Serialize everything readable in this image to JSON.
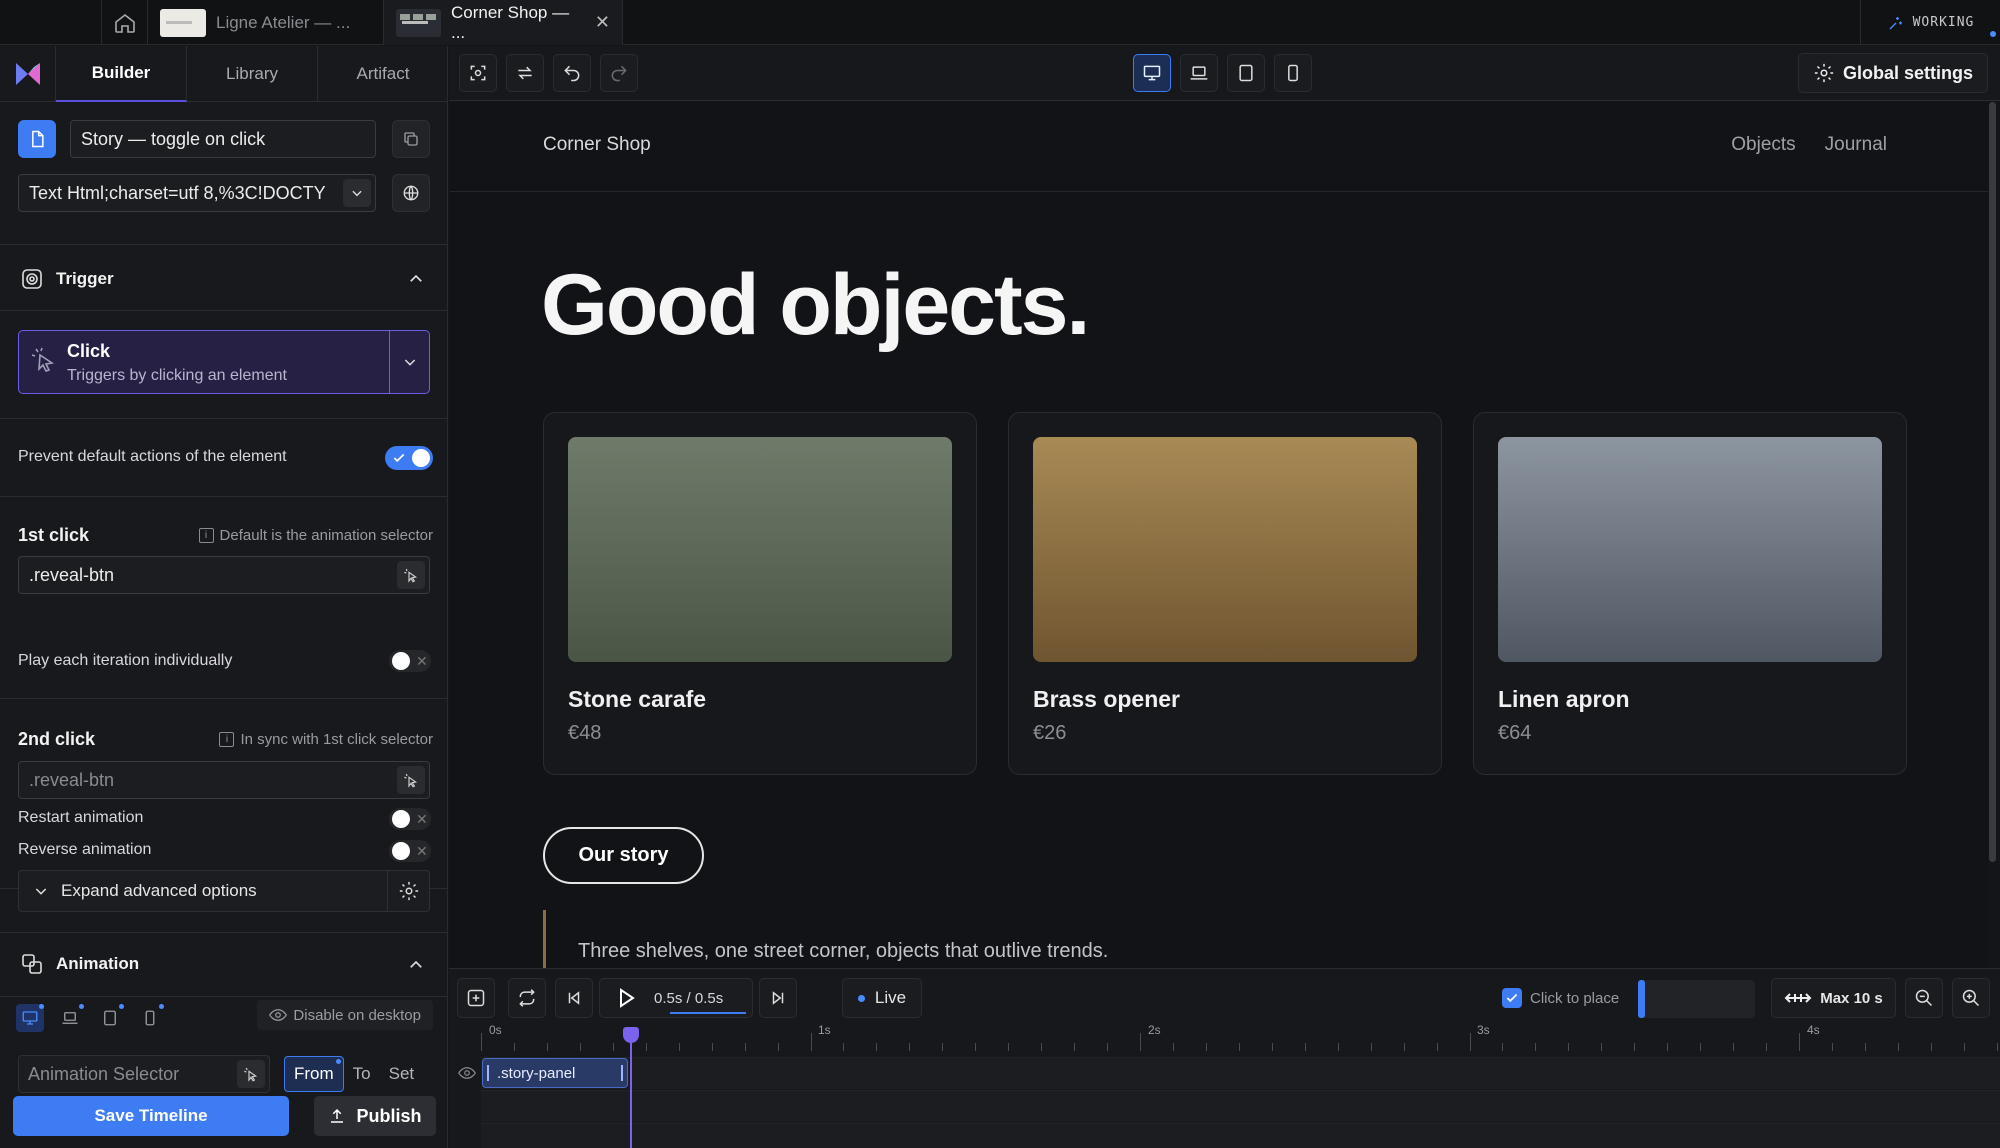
{
  "tabs": [
    {
      "label": "Ligne Atelier — ...",
      "active": false
    },
    {
      "label": "Corner Shop — ...",
      "active": true
    }
  ],
  "status": {
    "label": "WORKING"
  },
  "panel_tabs": [
    {
      "label": "Builder",
      "active": true
    },
    {
      "label": "Library",
      "active": false
    },
    {
      "label": "Artifact",
      "active": false
    }
  ],
  "story": {
    "name": "Story — toggle on click"
  },
  "url_field": {
    "value": "Text Html;charset=utf 8,%3C!DOCTY"
  },
  "trigger": {
    "section_title": "Trigger",
    "type": "Click",
    "description": "Triggers by clicking an element",
    "prevent_default_label": "Prevent default actions of the element",
    "prevent_default_on": true
  },
  "first_click": {
    "label": "1st click",
    "hint": "Default is the animation selector",
    "selector": ".reveal-btn",
    "play_each_label": "Play each iteration individually"
  },
  "second_click": {
    "label": "2nd click",
    "hint": "In sync with 1st click selector",
    "selector_placeholder": ".reveal-btn",
    "restart_label": "Restart animation",
    "reverse_label": "Reverse animation"
  },
  "advanced": {
    "label": "Expand advanced options"
  },
  "animation": {
    "section_title": "Animation",
    "disable_label": "Disable on desktop",
    "selector_placeholder": "Animation Selector",
    "modes": [
      "From",
      "To",
      "Set"
    ],
    "active_mode": "From"
  },
  "footer": {
    "save_label": "Save Timeline",
    "publish_label": "Publish"
  },
  "toolbar": {
    "global_settings_label": "Global settings"
  },
  "site": {
    "brand": "Corner Shop",
    "nav": [
      "Objects",
      "Journal"
    ],
    "headline": "Good objects.",
    "products": [
      {
        "name": "Stone carafe",
        "price": "€48",
        "color_top": "#6f7b6a",
        "color_bottom": "#4a5546"
      },
      {
        "name": "Brass opener",
        "price": "€26",
        "color_top": "#a88a55",
        "color_bottom": "#6f5530"
      },
      {
        "name": "Linen apron",
        "price": "€64",
        "color_top": "#8c95a0",
        "color_bottom": "#4f5763"
      }
    ],
    "cta": "Our story",
    "quote": "Three shelves, one street corner, objects that outlive trends."
  },
  "timeline": {
    "time_readout": "0.5s / 0.5s",
    "live_label": "Live",
    "click_to_place_label": "Click to place",
    "max_label": "Max 10 s",
    "ticks": [
      "0s",
      "1s",
      "2s",
      "3s",
      "4s"
    ],
    "clip_label": ".story-panel"
  },
  "colors": {
    "accent": "#3d7cf2",
    "purple": "#6b5fe6"
  }
}
